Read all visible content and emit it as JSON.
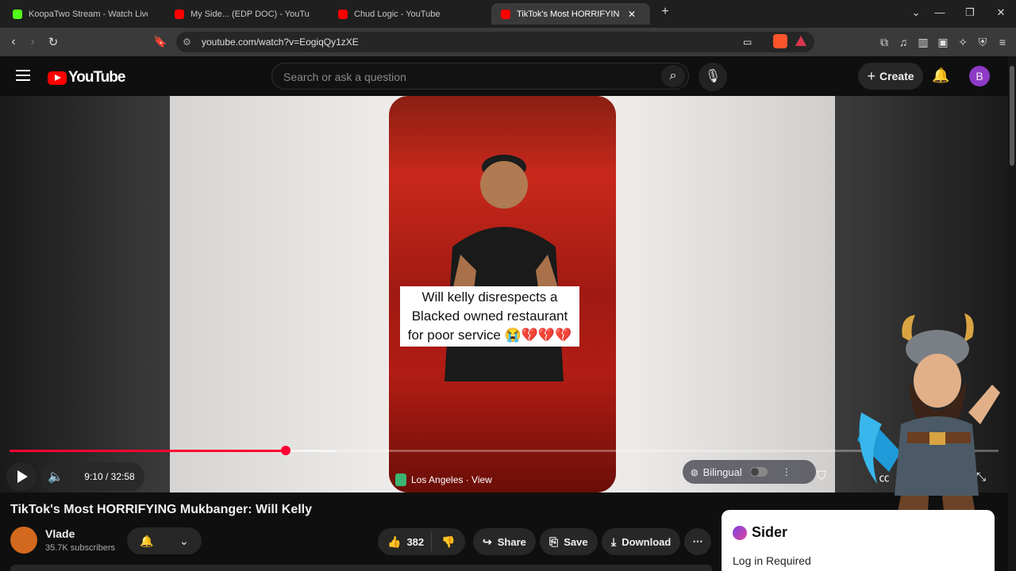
{
  "browser": {
    "tabs": [
      {
        "title": "KoopaTwo Stream - Watch Live o",
        "favicon": "kick-icon",
        "color": "#53fc18"
      },
      {
        "title": "My Side... (EDP DOC) - YouTube",
        "favicon": "youtube-icon",
        "color": "#ff0000"
      },
      {
        "title": "Chud Logic - YouTube",
        "favicon": "youtube-icon",
        "color": "#ff0000"
      },
      {
        "title": "TikTok's Most HORRIFYING Mukb",
        "favicon": "youtube-icon",
        "color": "#ff0000",
        "active": true
      }
    ],
    "new_tab": "+",
    "url": "youtube.com/watch?v=EogiqQy1zXE"
  },
  "youtube": {
    "logo_text": "YouTube",
    "search_placeholder": "Search or ask a question",
    "create_label": "Create",
    "avatar_letter": "B"
  },
  "player": {
    "video_caption": "Will kelly disrespects a Blacked owned restaurant for poor service 😭💔💔💔",
    "location": "Los Angeles · View",
    "time": "9:10 / 32:58",
    "progress_fraction": 0.279,
    "buffered_fraction": 0.33,
    "bilingual_label": "Bilingual"
  },
  "video": {
    "title": "TikTok's Most HORRIFYING Mukbanger: Will Kelly",
    "channel": "Vlade",
    "subscribers": "35.7K subscribers",
    "likes": "382",
    "share_label": "Share",
    "save_label": "Save",
    "download_label": "Download"
  },
  "sider": {
    "brand": "Sider",
    "message": "Log in Required"
  }
}
